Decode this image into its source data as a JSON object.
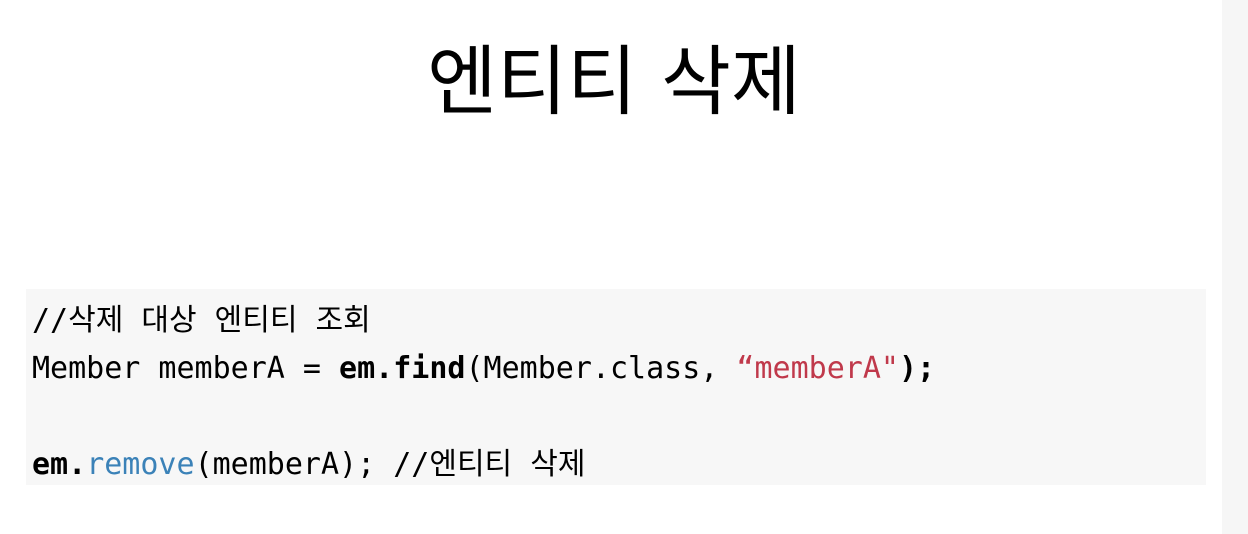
{
  "slide": {
    "title": "엔티티 삭제"
  },
  "code": {
    "line1_comment": "//삭제 대상 엔티티 조회",
    "line2_decl": "Member memberA = ",
    "line2_em_find": "em.find",
    "line2_args_open": "(Member.class, ",
    "line2_string": "“memberA\"",
    "line2_close": ");",
    "line4_em": "em.",
    "line4_remove": "remove",
    "line4_args": "(memberA); //엔티티 삭제"
  },
  "colors": {
    "string": "#c0394b",
    "method": "#3b82b8",
    "code_background": "#f7f7f7"
  }
}
